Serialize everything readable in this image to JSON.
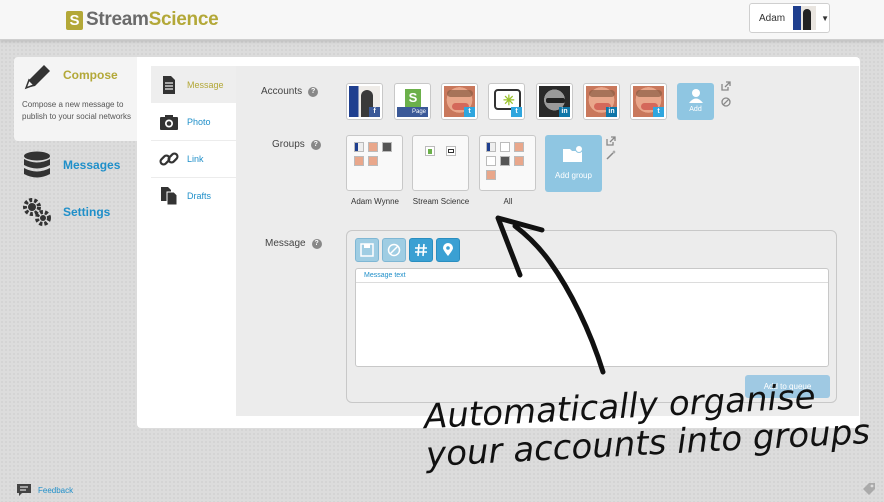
{
  "header": {
    "logo_letter": "S",
    "logo_part1": "Stream",
    "logo_part2": "Science",
    "user_name": "Adam"
  },
  "sidebar": {
    "compose": {
      "label": "Compose",
      "description": "Compose a new message to publish to your social networks"
    },
    "items": [
      {
        "label": "Messages",
        "icon": "database-icon"
      },
      {
        "label": "Settings",
        "icon": "gear-icon"
      }
    ]
  },
  "subnav": {
    "items": [
      {
        "label": "Message",
        "icon": "document-icon"
      },
      {
        "label": "Photo",
        "icon": "camera-icon"
      },
      {
        "label": "Link",
        "icon": "link-icon"
      },
      {
        "label": "Drafts",
        "icon": "drafts-icon"
      }
    ]
  },
  "accounts": {
    "label": "Accounts",
    "help": "?",
    "page_badge": "Page",
    "network_marks": {
      "facebook": "f",
      "twitter": "t",
      "linkedin": "in"
    },
    "add_label": "Add"
  },
  "groups": {
    "label": "Groups",
    "help": "?",
    "items": [
      {
        "label": "Adam Wynne"
      },
      {
        "label": "Stream Science"
      },
      {
        "label": "All"
      }
    ],
    "add_label": "Add group"
  },
  "message": {
    "label": "Message",
    "help": "?",
    "text_label": "Message text",
    "queue_button": "Add to queue"
  },
  "annotation": {
    "line1": "Automatically organise",
    "line2": "your accounts into groups"
  },
  "footer": {
    "feedback": "Feedback"
  },
  "colors": {
    "brand": "#b3a838",
    "link": "#1f8fc9",
    "facebook": "#3b5998",
    "twitter": "#2fa6de"
  }
}
